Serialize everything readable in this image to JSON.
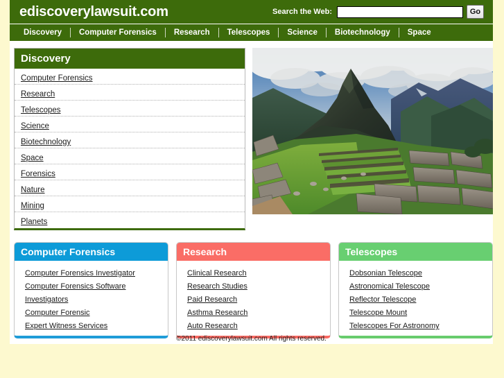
{
  "header": {
    "site_title": "ediscoverylawsuit.com",
    "search_label": "Search the Web:",
    "search_value": "",
    "search_placeholder": "",
    "go_label": "Go"
  },
  "nav": {
    "items": [
      {
        "label": "Discovery"
      },
      {
        "label": "Computer Forensics"
      },
      {
        "label": "Research"
      },
      {
        "label": "Telescopes"
      },
      {
        "label": "Science"
      },
      {
        "label": "Biotechnology"
      },
      {
        "label": "Space"
      }
    ]
  },
  "discovery": {
    "title": "Discovery",
    "links": [
      {
        "label": "Computer Forensics"
      },
      {
        "label": "Research"
      },
      {
        "label": "Telescopes"
      },
      {
        "label": "Science"
      },
      {
        "label": "Biotechnology"
      },
      {
        "label": "Space"
      },
      {
        "label": "Forensics"
      },
      {
        "label": "Nature"
      },
      {
        "label": "Mining"
      },
      {
        "label": "Planets"
      }
    ]
  },
  "hero": {
    "alt": "Machu Picchu Inca ruins with terraces and Huayna Picchu peak under cloudy sky"
  },
  "cards": [
    {
      "title": "Computer Forensics",
      "accent": "#0d9bd8",
      "links": [
        {
          "label": "Computer Forensics Investigator"
        },
        {
          "label": "Computer Forensics Software"
        },
        {
          "label": "Investigators"
        },
        {
          "label": "Computer Forensic"
        },
        {
          "label": "Expert Witness Services"
        }
      ]
    },
    {
      "title": "Research",
      "accent": "#fa6d66",
      "links": [
        {
          "label": "Clinical Research"
        },
        {
          "label": "Research Studies"
        },
        {
          "label": "Paid Research"
        },
        {
          "label": "Asthma Research"
        },
        {
          "label": "Auto Research"
        }
      ]
    },
    {
      "title": "Telescopes",
      "accent": "#68cf71",
      "links": [
        {
          "label": "Dobsonian Telescope"
        },
        {
          "label": "Astronomical Telescope"
        },
        {
          "label": "Reflector Telescope"
        },
        {
          "label": "Telescope Mount"
        },
        {
          "label": "Telescopes For Astronomy"
        }
      ]
    }
  ],
  "footer": {
    "copyright": "©2011 ediscoverylawsuit.com All rights reserved."
  },
  "colors": {
    "page_background": "#fdf9cf",
    "brand_green": "#3d6b0b",
    "card_blue": "#0d9bd8",
    "card_red": "#fa6d66",
    "card_green": "#68cf71"
  }
}
